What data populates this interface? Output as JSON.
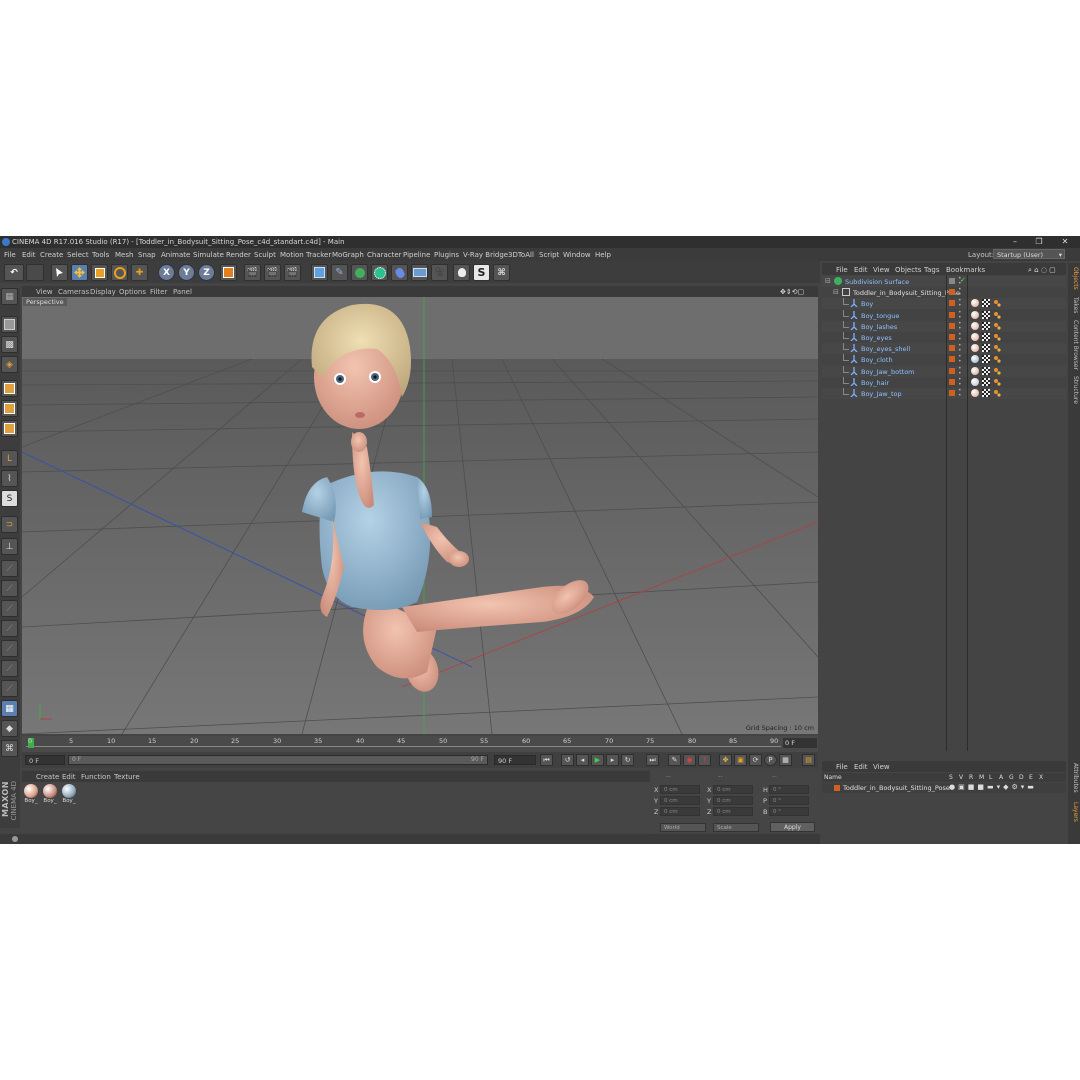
{
  "window": {
    "title": "CINEMA 4D R17.016 Studio (R17) - [Toddler_in_Bodysuit_Sitting_Pose_c4d_standart.c4d] - Main",
    "minimize": "–",
    "maximize": "❐",
    "close": "✕"
  },
  "menubar": {
    "items": [
      "File",
      "Edit",
      "Create",
      "Select",
      "Tools",
      "Mesh",
      "Snap",
      "Animate",
      "Simulate",
      "Render",
      "Sculpt",
      "Motion Tracker",
      "MoGraph",
      "Character",
      "Pipeline",
      "Plugins",
      "V-Ray Bridge",
      "3DToAll",
      "Script",
      "Window",
      "Help"
    ],
    "layout_label": "Layout:",
    "layout_value": "Startup (User)"
  },
  "toolbar": {
    "x_label": "X",
    "y_label": "Y",
    "z_label": "Z"
  },
  "viewport": {
    "menu": [
      "View",
      "Cameras",
      "Display",
      "Options",
      "Filter",
      "Panel"
    ],
    "camera_label": "Perspective",
    "grid_spacing": "Grid Spacing : 10 cm"
  },
  "timeline": {
    "ticks": [
      "0",
      "5",
      "10",
      "15",
      "20",
      "25",
      "30",
      "35",
      "40",
      "45",
      "50",
      "55",
      "60",
      "65",
      "70",
      "75",
      "80",
      "85",
      "90"
    ],
    "current_frame": "0 F",
    "start_field": "0 F",
    "range_start": "0 F",
    "range_end": "90 F",
    "end_field": "90 F"
  },
  "materials": {
    "menu": [
      "Create",
      "Edit",
      "Function",
      "Texture"
    ],
    "items": [
      {
        "label": "Boy_",
        "color": "#d9a089"
      },
      {
        "label": "Boy_",
        "color": "#c98a7c"
      },
      {
        "label": "Boy_",
        "color": "#8fa9c0"
      }
    ]
  },
  "coordinates": {
    "header": [
      "--",
      "--",
      "--"
    ],
    "rows": [
      {
        "a": "X",
        "av": "0 cm",
        "b": "X",
        "bv": "0 cm",
        "c": "H",
        "cv": "0 °"
      },
      {
        "a": "Y",
        "av": "0 cm",
        "b": "Y",
        "bv": "0 cm",
        "c": "P",
        "cv": "0 °"
      },
      {
        "a": "Z",
        "av": "0 cm",
        "b": "Z",
        "bv": "0 cm",
        "c": "B",
        "cv": "0 °"
      }
    ],
    "mode_select": "World",
    "scale_select": "Scale",
    "apply": "Apply"
  },
  "object_manager": {
    "menu": [
      "File",
      "Edit",
      "View",
      "Objects",
      "Tags",
      "Bookmarks"
    ],
    "objects": [
      {
        "name": "Subdivision Surface",
        "level": 0,
        "kind": "subdiv"
      },
      {
        "name": "Toddler_in_Bodysuit_Sitting_Pose",
        "level": 1,
        "kind": "null"
      },
      {
        "name": "Boy",
        "level": 2,
        "kind": "mesh",
        "mat": "#d9a089"
      },
      {
        "name": "Boy_tongue",
        "level": 2,
        "kind": "mesh",
        "mat": "#d9a089"
      },
      {
        "name": "Boy_lashes",
        "level": 2,
        "kind": "mesh",
        "mat": "#d9a089"
      },
      {
        "name": "Boy_eyes",
        "level": 2,
        "kind": "mesh",
        "mat": "#d9a089"
      },
      {
        "name": "Boy_eyes_shell",
        "level": 2,
        "kind": "mesh",
        "mat": "#d9a089"
      },
      {
        "name": "Boy_cloth",
        "level": 2,
        "kind": "mesh",
        "mat": "#8fa9c0"
      },
      {
        "name": "Boy_Jaw_bottom",
        "level": 2,
        "kind": "mesh",
        "mat": "#d9a089"
      },
      {
        "name": "Boy_hair",
        "level": 2,
        "kind": "mesh",
        "mat": "#b8b8c8"
      },
      {
        "name": "Boy_Jaw_top",
        "level": 2,
        "kind": "mesh",
        "mat": "#d9a089"
      }
    ]
  },
  "layer_manager": {
    "menu": [
      "File",
      "Edit",
      "View"
    ],
    "columns": [
      "Name",
      "S",
      "V",
      "R",
      "M",
      "L",
      "A",
      "G",
      "D",
      "E",
      "X"
    ],
    "layer_name": "Toddler_in_Bodysuit_Sitting_Pose"
  },
  "side_tabs": [
    "Objects",
    "Takes",
    "Content Browser",
    "Structure",
    "Attributes",
    "Layers"
  ],
  "branding": {
    "line1": "MAXON",
    "line2": "CINEMA 4D"
  }
}
